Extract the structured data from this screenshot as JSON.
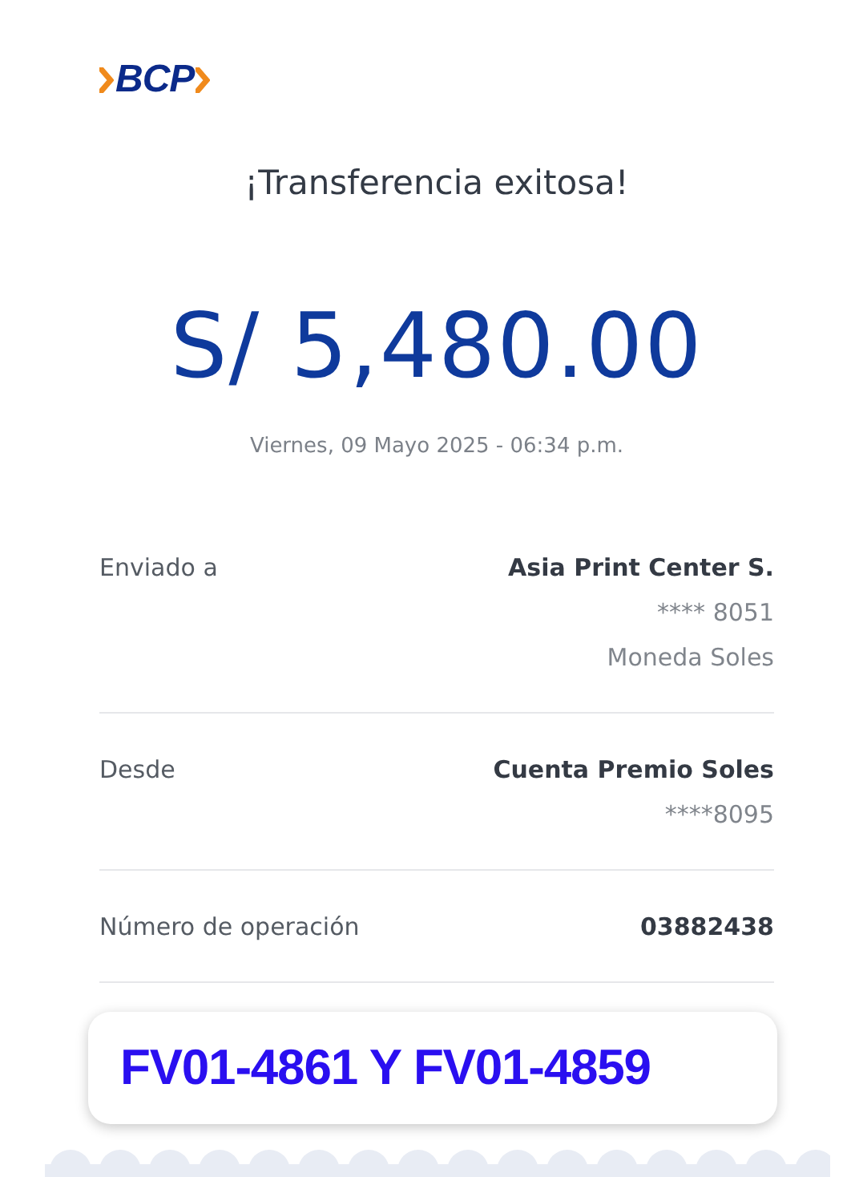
{
  "logo": {
    "text": "BCP"
  },
  "title": "¡Transferencia exitosa!",
  "amount": "S/ 5,480.00",
  "date": "Viernes, 09 Mayo 2025 - 06:34 p.m.",
  "details": [
    {
      "label": "Enviado a",
      "lines": [
        "Asia Print Center S.",
        "**** 8051",
        "Moneda Soles"
      ]
    },
    {
      "label": "Desde",
      "lines": [
        "Cuenta Premio Soles",
        "****8095"
      ]
    },
    {
      "label": "Número de operación",
      "lines": [
        "03882438"
      ]
    }
  ],
  "note": "FV01-4861 Y FV01-4859"
}
